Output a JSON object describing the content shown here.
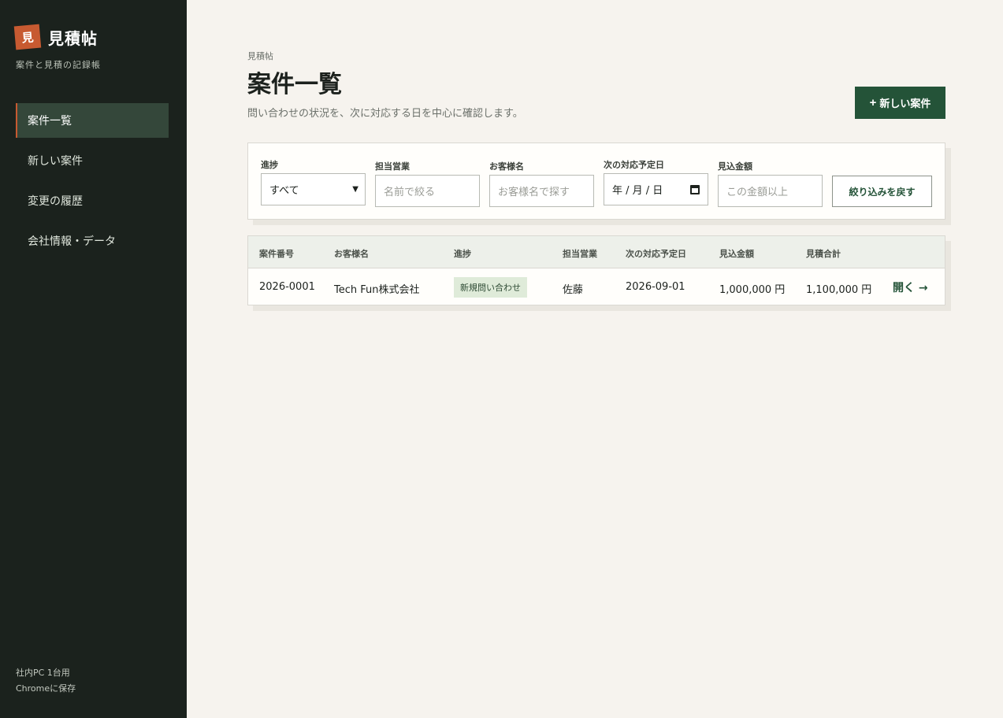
{
  "sidebar": {
    "logo_char": "見",
    "app_name": "見積帖",
    "tagline": "案件と見積の記録帳",
    "items": [
      {
        "label": "案件一覧"
      },
      {
        "label": "新しい案件"
      },
      {
        "label": "変更の履歴"
      },
      {
        "label": "会社情報・データ"
      }
    ],
    "footer_line1": "社内PC 1台用",
    "footer_line2": "Chromeに保存"
  },
  "header": {
    "breadcrumb": "見積帖",
    "title": "案件一覧",
    "subtitle": "問い合わせの状況を、次に対応する日を中心に確認します。",
    "new_button_icon": "+",
    "new_button": "新しい案件"
  },
  "filters": {
    "progress_label": "進捗",
    "progress_value": "すべて",
    "sales_label": "担当営業",
    "sales_placeholder": "名前で絞る",
    "customer_label": "お客様名",
    "customer_placeholder": "お客様名で探す",
    "next_date_label": "次の対応予定日",
    "next_date_placeholder": "年 / 月 / 日",
    "amount_label": "見込金額",
    "amount_placeholder": "この金額以上",
    "reset_button": "絞り込みを戻す"
  },
  "table": {
    "columns": [
      "案件番号",
      "お客様名",
      "進捗",
      "担当営業",
      "次の対応予定日",
      "見込金額",
      "見積合計"
    ],
    "rows": [
      {
        "id": "2026-0001",
        "customer": "Tech Fun株式会社",
        "status": "新規問い合わせ",
        "sales": "佐藤",
        "next_date": "2026-09-01",
        "expected": "1,000,000 円",
        "total": "1,100,000 円",
        "open": "開く →"
      }
    ]
  },
  "colors": {
    "sidebar_bg": "#1b221d",
    "accent": "#c75a31",
    "primary": "#245338",
    "page_bg": "#f6f3ee"
  }
}
